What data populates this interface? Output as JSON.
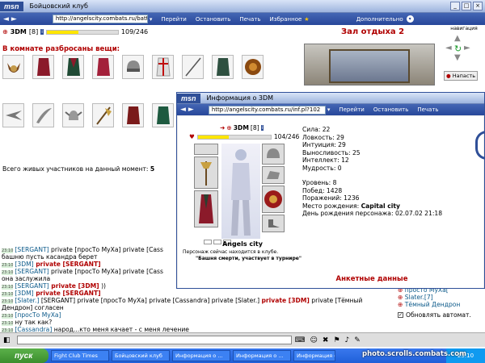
{
  "main_window": {
    "msn": "msn",
    "title": "Бойцовский клуб",
    "url": "http://angelscity.combats.ru/battle2.ht",
    "nav": [
      "Перейти",
      "Остановить",
      "Печать",
      "Избранное"
    ],
    "extra": "Дополнительно"
  },
  "player": {
    "name": "3DM",
    "level": "[8]",
    "hp": "109/246",
    "hp_fraction": 0.44
  },
  "room": {
    "title": "Зал отдыха 2",
    "items_heading": "В комнате разбросаны вещи:",
    "participants_label": "Всего живых участников на данный момент:",
    "participants_count": "5"
  },
  "navigation": {
    "label": "навигация",
    "attack": "Напасть"
  },
  "popup": {
    "msn": "msn",
    "title": "Информация о 3DM",
    "url": "http://angelscity.combats.ru/inf.pl?102",
    "nav": [
      "Перейти",
      "Остановить",
      "Печать"
    ],
    "char_name": "3DM",
    "char_level": "[8]",
    "char_hp": "104/246",
    "hp_fraction": 0.42,
    "city": "Angels city",
    "location_text": "Персонаж сейчас находится в клубе.",
    "location_sub": "\"Башня смерти, участвует в турнире\"",
    "stats": [
      "Сила: 22",
      "Ловкость: 29",
      "Интуиция: 29",
      "Выносливость: 25",
      "Интеллект: 12",
      "Мудрость: 0"
    ],
    "info": [
      "Уровень: 8",
      "Побед: 1428",
      "Поражений: 1236"
    ],
    "birthplace_label": "Место рождения:",
    "birthplace": "Capital city",
    "birthday_label": "День рождения персонажа:",
    "birthday": "02.07.02 21:18",
    "footer": "Анкетные данные"
  },
  "chat": {
    "lines": [
      {
        "time": "23:10",
        "parts": [
          [
            "nick",
            "[SERGANT]"
          ],
          [
            "txt",
            " private [просТо МуХа] private [Cass"
          ]
        ]
      },
      {
        "time": "",
        "parts": [
          [
            "txt",
            "башню пусть касандра берет"
          ]
        ]
      },
      {
        "time": "23:10",
        "parts": [
          [
            "nick",
            "[3DM]"
          ],
          [
            "prv",
            " private [SERGANT]"
          ]
        ]
      },
      {
        "time": "23:10",
        "parts": [
          [
            "nick",
            "[SERGANT]"
          ],
          [
            "txt",
            " private [просТо МуХа] private [Cass"
          ]
        ]
      },
      {
        "time": "",
        "parts": [
          [
            "txt",
            "она заслужила"
          ]
        ]
      },
      {
        "time": "23:10",
        "parts": [
          [
            "nick",
            "[SERGANT]"
          ],
          [
            "prv",
            " private [3DM]"
          ],
          [
            "txt",
            " ))"
          ]
        ]
      },
      {
        "time": "23:10",
        "parts": [
          [
            "nick",
            "[3DM]"
          ],
          [
            "prv",
            " private [SERGANT]"
          ]
        ]
      },
      {
        "time": "23:10",
        "parts": [
          [
            "nick",
            "[Slater.]"
          ],
          [
            "txt",
            " [SERGANT] private [просТо МуХа] private [Cassandra] private [Slater.] "
          ],
          [
            "prv",
            "private [3DM]"
          ],
          [
            "txt",
            " private [Тёмный"
          ]
        ]
      },
      {
        "time": "",
        "parts": [
          [
            "txt",
            "Дендрон] согласен"
          ]
        ]
      },
      {
        "time": "23:10",
        "parts": [
          [
            "nick",
            "[просТо МуХа]"
          ]
        ]
      },
      {
        "time": "23:10",
        "parts": [
          [
            "txt",
            "ну так как?"
          ]
        ]
      },
      {
        "time": "23:10",
        "parts": [
          [
            "nick",
            "[Cassandra]"
          ],
          [
            "txt",
            " народ...кто меня качает - с меня лечение"
          ]
        ]
      }
    ]
  },
  "side_list": {
    "items": [
      "просто МуХа[",
      "Slater.[7]",
      "Тёмный Дендрон"
    ],
    "auto_update": "Обновлять автомат."
  },
  "taskbar": {
    "start": "пуск",
    "tasks": [
      "Fight Club Times",
      "Бойцовский клуб",
      "Информация о ...",
      "Информация о ...",
      "Информация о ..."
    ],
    "clock": "23:10"
  },
  "watermark": "photo.scrolls.combats.com",
  "colors": {
    "accent": "#2f4f98",
    "hp": "#ffe600",
    "title_red": "#b00000"
  }
}
